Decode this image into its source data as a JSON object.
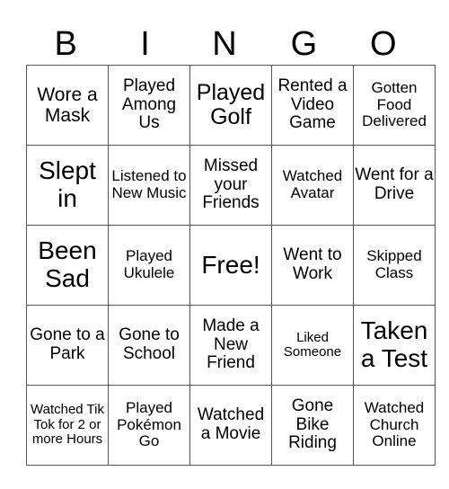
{
  "header": {
    "letters": [
      "B",
      "I",
      "N",
      "G",
      "O"
    ]
  },
  "rows": [
    [
      "Wore a Mask",
      "Played Among Us",
      "Played Golf",
      "Rented a Video Game",
      "Gotten Food Delivered"
    ],
    [
      "Slept in",
      "Listened to New Music",
      "Missed your Friends",
      "Watched Avatar",
      "Went for a Drive"
    ],
    [
      "Been Sad",
      "Played Ukulele",
      "Free!",
      "Went to Work",
      "Skipped Class"
    ],
    [
      "Gone to a Park",
      "Gone to School",
      "Made a New Friend",
      "Liked Someone",
      "Taken a Test"
    ],
    [
      "Watched Tik Tok for 2 or more Hours",
      "Played Pokémon Go",
      "Watched a Movie",
      "Gone Bike Riding",
      "Watched Church Online"
    ]
  ]
}
